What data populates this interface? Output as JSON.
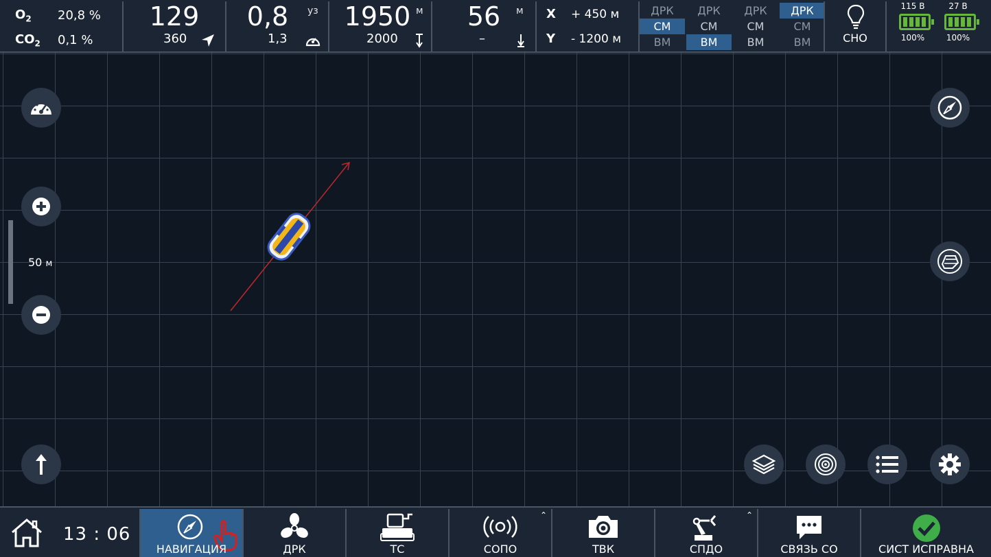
{
  "gas": {
    "o2_label": "O",
    "o2_sub": "2",
    "o2_value": "20,8 %",
    "co2_label": "CO",
    "co2_sub": "2",
    "co2_value": "0,1 %"
  },
  "heading": {
    "value": "129",
    "setpoint": "360"
  },
  "speed": {
    "value": "0,8",
    "unit": "уз",
    "setpoint": "1,3"
  },
  "depth": {
    "value": "1950",
    "unit": "м",
    "setpoint": "2000"
  },
  "altitude": {
    "value": "56",
    "unit": "м",
    "setpoint": "–"
  },
  "position": {
    "x_label": "X",
    "x_value": "+ 450 м",
    "y_label": "Y",
    "y_value": "- 1200 м"
  },
  "drk_columns": [
    {
      "top": "ДРК",
      "mid": "СМ",
      "bot": "ВМ",
      "active": "mid"
    },
    {
      "top": "ДРК",
      "mid": "СМ",
      "bot": "ВМ",
      "active": "bot"
    },
    {
      "top": "ДРК",
      "mid": "СМ",
      "bot": "ВМ",
      "active": "none"
    },
    {
      "top": "ДРК",
      "mid": "СМ",
      "bot": "ВМ",
      "active": "top"
    }
  ],
  "light": {
    "label": "СНО"
  },
  "batteries": [
    {
      "voltage": "115 В",
      "percent": "100%",
      "level": 1.0
    },
    {
      "voltage": "27 В",
      "percent": "100%",
      "level": 1.0
    }
  ],
  "map": {
    "scale_value": "50",
    "scale_unit": "м"
  },
  "bottom": {
    "time": "13 : 06",
    "tabs": [
      {
        "label": "НАВИГАЦИЯ"
      },
      {
        "label": "ДРК"
      },
      {
        "label": "ТС"
      },
      {
        "label": "СОПО"
      },
      {
        "label": "ТВК"
      },
      {
        "label": "СПДО"
      },
      {
        "label": "СВЯЗЬ СО"
      },
      {
        "label": "СИСТ ИСПРАВНА"
      }
    ]
  },
  "colors": {
    "accent": "#2e5f8f",
    "panel": "#1b2533",
    "map_bg": "#0f1722",
    "ok_green": "#3fae49",
    "battery": "#67b73a",
    "track": "#c0262d",
    "hand": "#d62020"
  },
  "icons": [
    "gauge-icon",
    "zoom-in-icon",
    "zoom-out-icon",
    "north-up-icon",
    "compass-icon",
    "vehicle-view-icon",
    "layers-icon",
    "sonar-icon",
    "list-icon",
    "settings-icon",
    "home-icon",
    "propeller-icon",
    "robot-arm-icon",
    "camera-icon",
    "chat-icon",
    "check-icon",
    "lightbulb-icon",
    "battery-icon"
  ]
}
